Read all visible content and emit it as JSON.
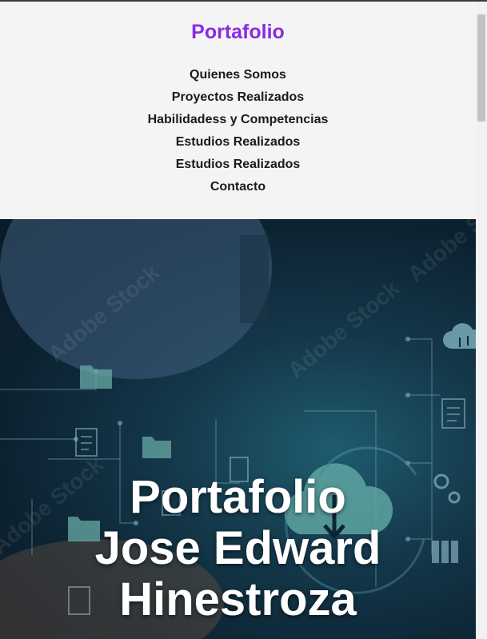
{
  "header": {
    "brand": "Portafolio",
    "nav": [
      "Quienes Somos",
      "Proyectos Realizados",
      "Habilidadess y Competencias",
      "Estudios Realizados",
      "Estudios Realizados",
      "Contacto"
    ]
  },
  "hero": {
    "title_lines": [
      "Portafolio",
      "Jose Edward",
      "Hinestroza"
    ],
    "watermark": "Adobe Stock"
  },
  "colors": {
    "brand": "#8a2be2",
    "nav_text": "#1a1a1a",
    "header_bg": "#f4f4f4",
    "hero_text": "#ffffff"
  },
  "icons": [
    "folder-icon",
    "document-icon",
    "cloud-download-icon",
    "gear-icon",
    "cloud-transfer-icon",
    "binder-icon"
  ]
}
